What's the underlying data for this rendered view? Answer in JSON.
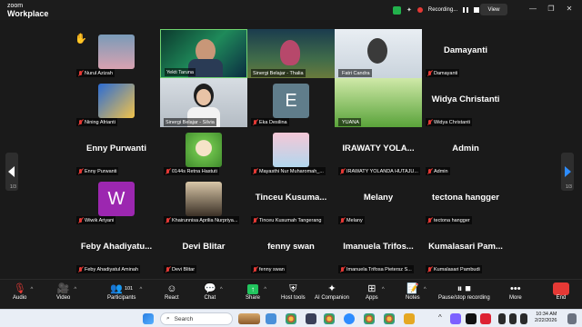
{
  "app": {
    "logo_line1": "zoom",
    "logo_line2": "Workplace"
  },
  "recording": {
    "label": "Recording..."
  },
  "view_label": "View",
  "pages": {
    "left": "1/3",
    "right": "1/3"
  },
  "tiles": [
    {
      "caption": "Nurul Azizah",
      "big": ""
    },
    {
      "caption": "Yekti Taruna",
      "big": ""
    },
    {
      "caption": "Sinergi Belajar - Thalia",
      "big": ""
    },
    {
      "caption": "Fatri Candra",
      "big": ""
    },
    {
      "caption": "Damayanti",
      "big": "Damayanti"
    },
    {
      "caption": "Nining Afrianti",
      "big": ""
    },
    {
      "caption": "Sinergi Belajar - Silvia",
      "big": ""
    },
    {
      "caption": "Eka Desilina",
      "big": "",
      "letter": "E"
    },
    {
      "caption": "YUANA",
      "big": ""
    },
    {
      "caption": "Widya Christanti",
      "big": "Widya Christanti"
    },
    {
      "caption": "Enny Purwanti",
      "big": "Enny Purwanti"
    },
    {
      "caption": "0144s Retna Hastuti",
      "big": ""
    },
    {
      "caption": "Mayasthi Nur Muharomah_...",
      "big": ""
    },
    {
      "caption": "IRAWATY YOLANDA HUTAJU...",
      "big": "IRAWATY YOLA..."
    },
    {
      "caption": "Admin",
      "big": "Admin"
    },
    {
      "caption": "Wiwik Ariyani",
      "big": "",
      "letter": "W"
    },
    {
      "caption": "Khairunnisa Aprilia Nurpriya...",
      "big": ""
    },
    {
      "caption": "Tinceu Kusumah Tangerang",
      "big": "Tinceu Kusuma..."
    },
    {
      "caption": "Melany",
      "big": "Melany"
    },
    {
      "caption": "tectona hangger",
      "big": "tectona hangger"
    },
    {
      "caption": "Feby Ahadiyatul Aminah",
      "big": "Feby Ahadiyatu..."
    },
    {
      "caption": "Devi Blitar",
      "big": "Devi Blitar"
    },
    {
      "caption": "fenny swan",
      "big": "fenny swan"
    },
    {
      "caption": "Imanuela Trifosa Pietersz S...",
      "big": "Imanuela Trifos..."
    },
    {
      "caption": "Kumalasari Pambudi",
      "big": "Kumalasari Pam..."
    }
  ],
  "toolbar": {
    "audio": "Audio",
    "video": "Video",
    "participants": "Participants",
    "participants_count": "101",
    "react": "React",
    "chat": "Chat",
    "share": "Share",
    "host_tools": "Host tools",
    "ai_companion": "AI Companion",
    "apps": "Apps",
    "notes": "Notes",
    "recording": "Pause/stop recording",
    "more": "More",
    "end": "End"
  },
  "taskbar": {
    "search": "Search",
    "time": "10:34 AM",
    "date": "2/22/2026"
  },
  "colors": {
    "end": "#e53935",
    "share": "#22c55e",
    "accent": "#2d8cff"
  }
}
